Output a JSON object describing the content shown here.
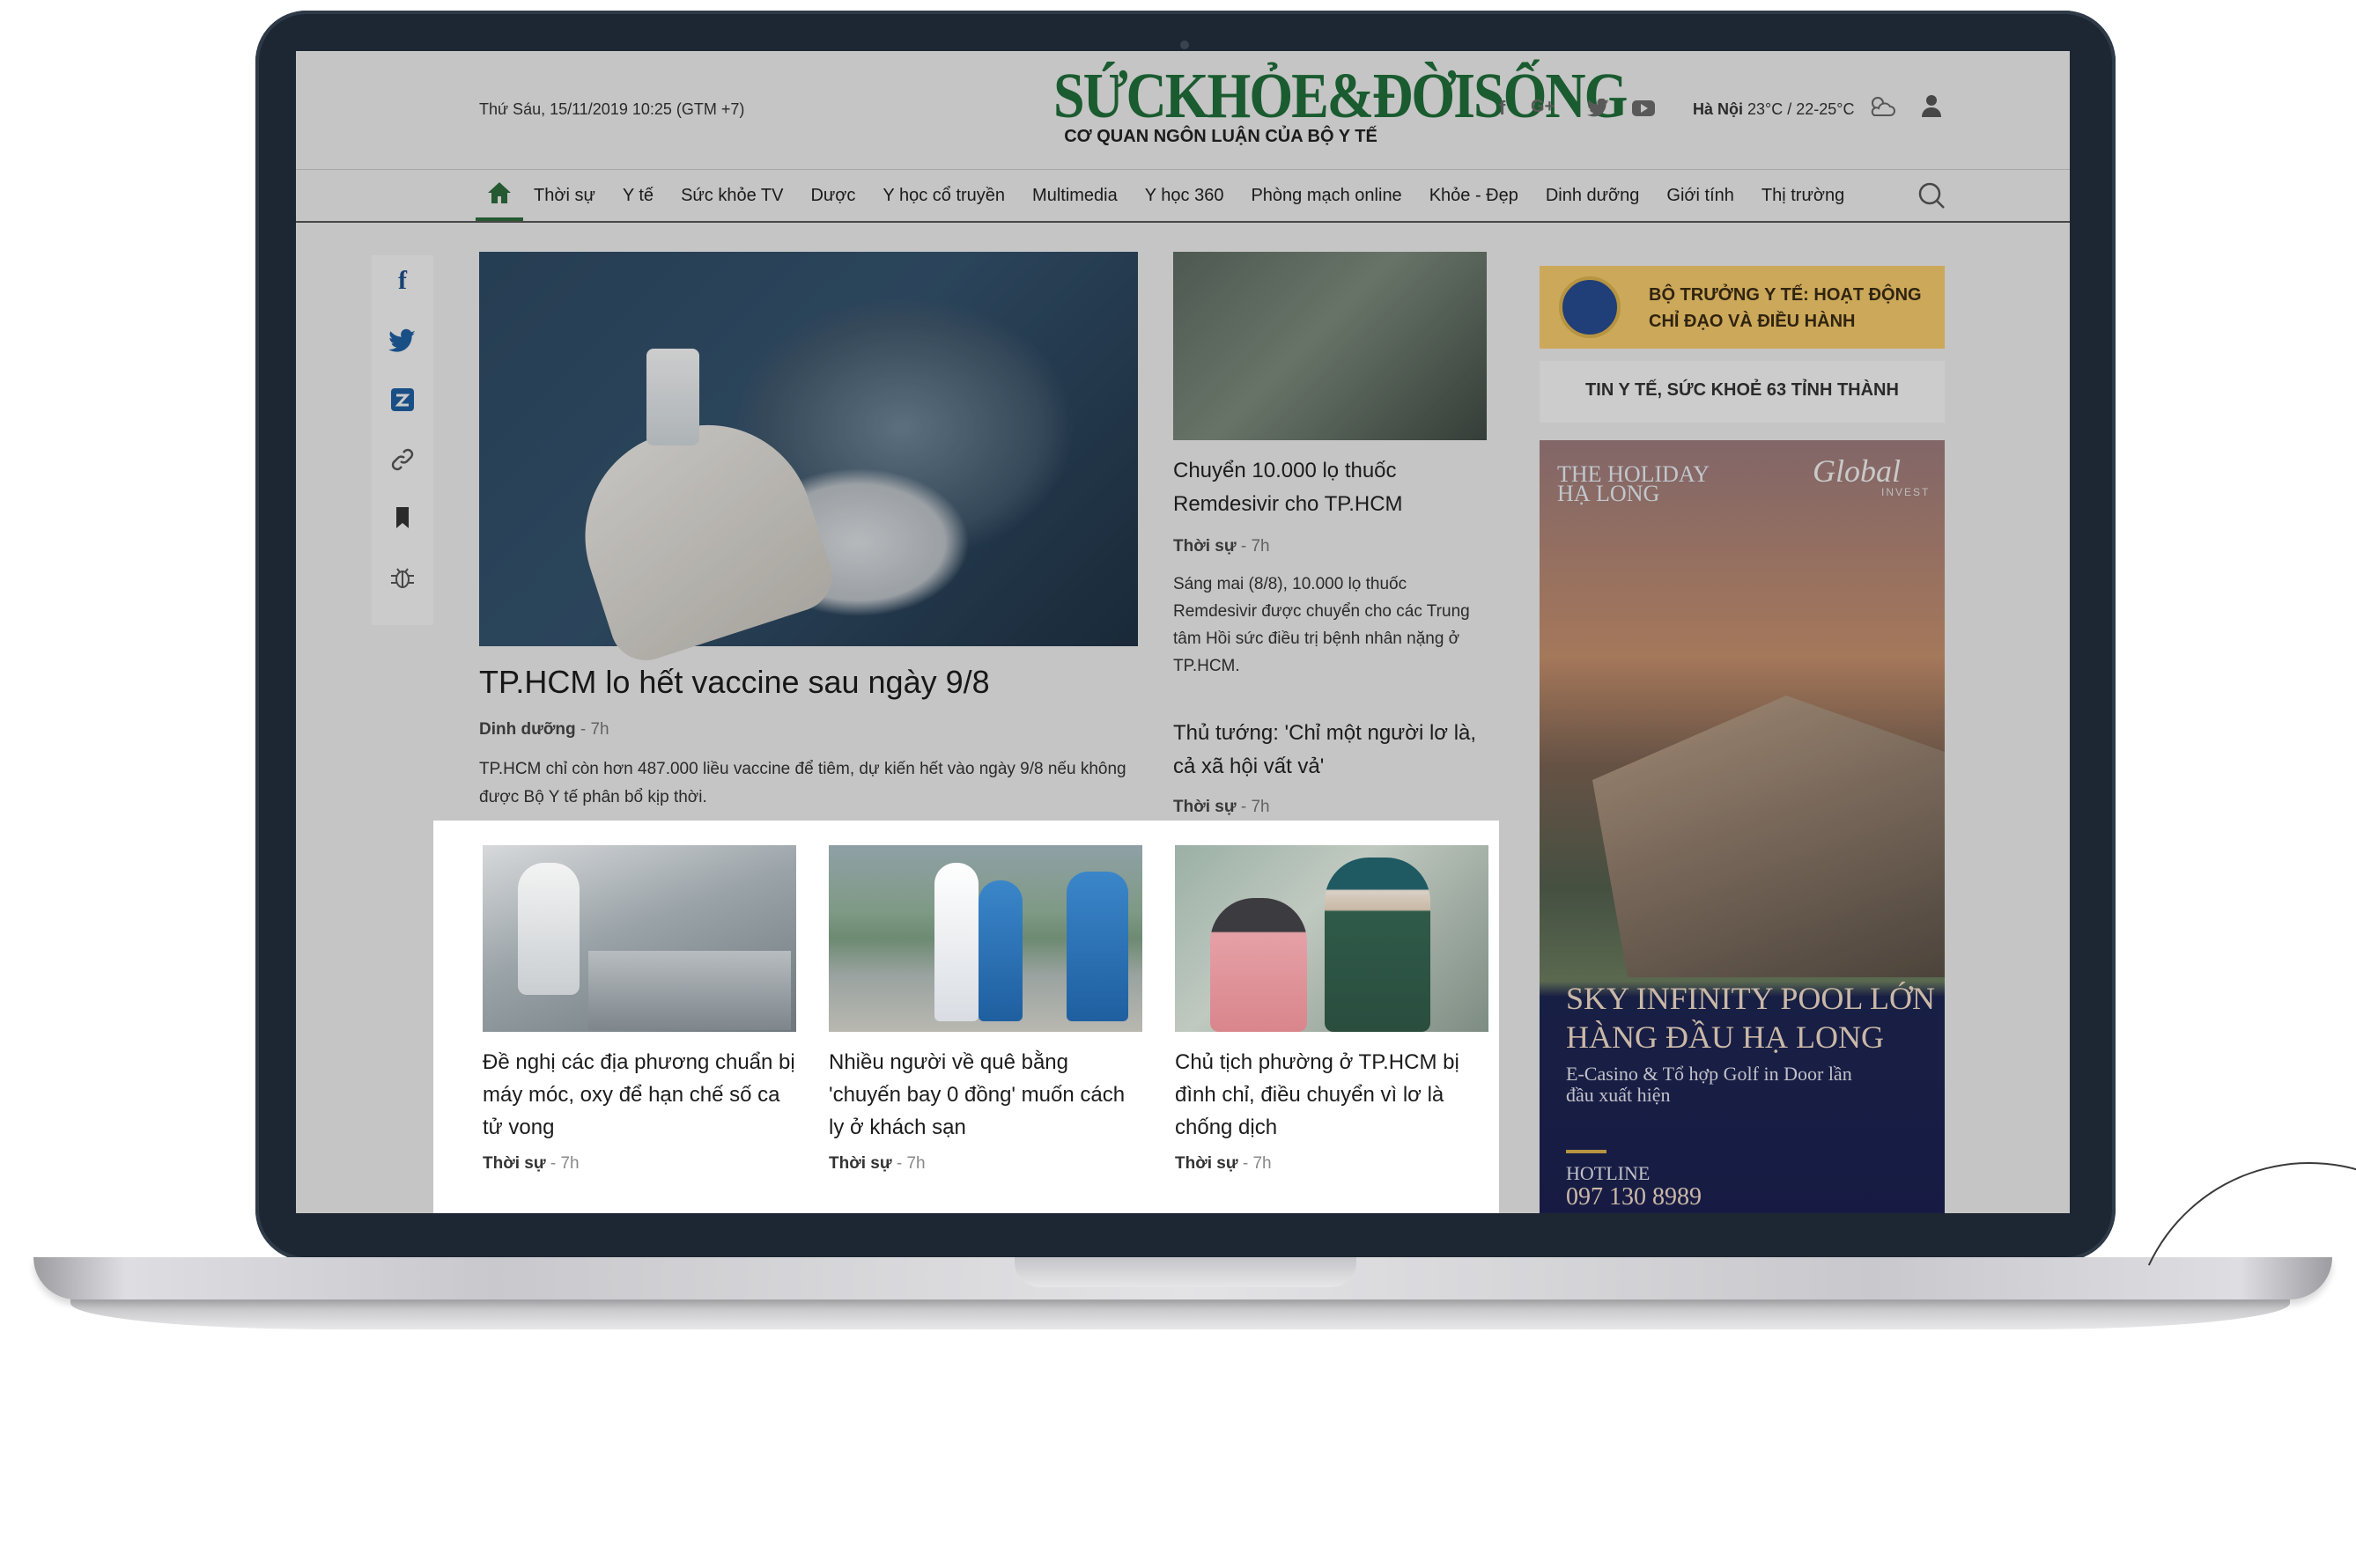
{
  "header": {
    "date": "Thứ Sáu, 15/11/2019   10:25 (GTM +7)",
    "logo_main": "SỨCKHỎE&ĐỜISỐNG",
    "logo_sub": "CƠ QUAN NGÔN LUẬN CỦA BỘ Y TẾ",
    "social": {
      "facebook": "f",
      "google": "G+"
    },
    "weather_city": "Hà Nội",
    "weather_temp": "23°C / 22-25°C"
  },
  "nav": {
    "items": [
      "Thời sự",
      "Y tế",
      "Sức khỏe TV",
      "Dược",
      "Y học cổ truyền",
      "Multimedia",
      "Y học 360",
      "Phòng mạch online",
      "Khỏe - Đẹp",
      "Dinh dưỡng",
      "Giới tính",
      "Thị trường"
    ]
  },
  "share": {
    "facebook": "f"
  },
  "hero": {
    "title": "TP.HCM lo hết vaccine sau ngày 9/8",
    "category": "Dinh dưỡng",
    "time": " - 7h",
    "summary": "TP.HCM chỉ còn hơn 487.000 liều vaccine để tiêm, dự kiến hết vào ngày 9/8 nếu không được Bộ Y tế phân bổ kịp thời."
  },
  "mid": {
    "article1": {
      "title": "Chuyển 10.000 lọ thuốc Remdesivir cho TP.HCM",
      "category": "Thời sự",
      "time": " - 7h",
      "summary": "Sáng mai (8/8), 10.000 lọ thuốc Remdesivir được chuyển cho các Trung tâm Hồi sức điều trị bệnh nhân nặng ở TP.HCM."
    },
    "article2": {
      "title": "Thủ tướng: 'Chỉ một người lơ là, cả xã hội vất vả'",
      "category": "Thời sự",
      "time": " - 7h"
    }
  },
  "sidebar": {
    "box1": "BỘ TRƯỞNG Y TẾ: HOẠT ĐỘNG CHỈ ĐẠO VÀ ĐIỀU HÀNH",
    "box2": "TIN Y TẾ, SỨC KHOẺ 63 TỈNH THÀNH",
    "ad": {
      "brand": "THE HOLIDAY HẠ LONG",
      "logo": "Global",
      "logo_sub": "INVEST",
      "headline": "SKY INFINITY POOL LỚN HÀNG ĐẦU HẠ LONG",
      "subline": "E-Casino & Tổ hợp Golf in Door lần đầu xuất hiện",
      "hotline_label": "HOTLINE",
      "hotline": "097 130 8989"
    }
  },
  "cards": [
    {
      "title": "Đề nghị các địa phương chuẩn bị máy móc, oxy để hạn chế số ca tử vong",
      "category": "Thời sự",
      "time": " - 7h"
    },
    {
      "title": "Nhiều người về quê bằng 'chuyến bay 0 đồng' muốn cách ly ở khách sạn",
      "category": "Thời sự",
      "time": " - 7h"
    },
    {
      "title": "Chủ tịch phường ở TP.HCM bị đình chỉ, điều chuyển vì lơ là chống dịch",
      "category": "Thời sự",
      "time": " - 7h"
    }
  ],
  "colors": {
    "brand_green": "#1f6d3a",
    "bezel": "#1d2733",
    "ad_navy": "#1c2150",
    "highlight_box": "#f4c96c"
  }
}
